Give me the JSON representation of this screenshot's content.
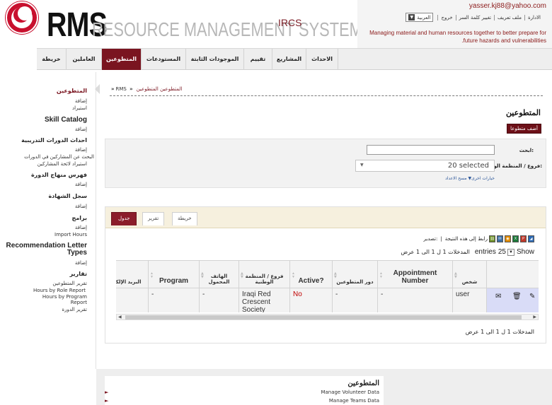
{
  "header": {
    "brand_main": "RMS",
    "brand_sub": "RESOURCE MANAGEMENT SYSTEM",
    "brand_org": "IRCS",
    "user_email": "yasser.kj88@yahoo.com",
    "top_links": [
      "العربية",
      "خروج",
      "تغيير كلمة السر",
      "ملف تعريف",
      "الادارة"
    ],
    "tagline": "Managing material and human resources together to better prepare for .future hazards and vulnerabilities"
  },
  "nav": {
    "items": [
      "خريطة",
      "العاملين",
      "المتطوعين",
      "المستودعات",
      "الموجودات الثابتة",
      "تقييم",
      "المشاريع",
      "الاحداث"
    ]
  },
  "sidebar": {
    "sections": [
      {
        "title": "المتطوعين",
        "links": [
          "إضافة",
          "استيراد"
        ]
      },
      {
        "title": "Skill Catalog",
        "links": [
          "إضافة"
        ]
      },
      {
        "title": "احداث الدورات التدريبية",
        "links": [
          "إضافة",
          "البحث عن المشاركين في الدورات",
          "استيراد لائحة المشاركين"
        ]
      },
      {
        "title": "فهرس منهاج الدورة",
        "links": [
          "إضافة"
        ]
      },
      {
        "title": "سجل الشهادة",
        "links": [
          "إضافة"
        ]
      },
      {
        "title": "برامج",
        "links": [
          "إضافة",
          "Import Hours"
        ]
      },
      {
        "title": "Recommendation Letter Types",
        "links": [
          "إضافة"
        ]
      },
      {
        "title": "تقارير",
        "links": [
          "تقرير المتطوعين",
          "Hours by Role Report",
          "Hours by Program Report",
          "تقرير الدورة"
        ]
      }
    ]
  },
  "breadcrumb": {
    "root": "RMS",
    "sep": "»",
    "section": "المتطوعين",
    "current": "المتطوعين"
  },
  "page": {
    "title": "المتطوعين",
    "add_button": "أضف متطوعا"
  },
  "filters": {
    "search_label": "ابحث:",
    "search_value": "",
    "branch_label": "فروع / المنظمة الوطنية:",
    "branch_value": "20 selected",
    "more_options": "خيارات اخرى▼ مسح الاعداد"
  },
  "tabs": [
    "جدول",
    "تقرير",
    "خريطة"
  ],
  "export": {
    "link": "رابط إلى هذه النتيجة",
    "sep": "|",
    "label": "تصدير:"
  },
  "entries_info_top": "المدخلات 1 ل 1 الى 1 عرض",
  "show_entries": {
    "show": "Show",
    "count": "25",
    "entries": "entries"
  },
  "table": {
    "columns": [
      "البريد الإلكتروني",
      "Program",
      "الهاتف المحمول",
      "فروع / المنظمة الوطنية",
      "Active?",
      "دور المتطوعين",
      "Appointment Number",
      "شخص",
      ""
    ],
    "rows": [
      {
        "email": "-",
        "program": "-",
        "mobile": "-",
        "branch": "Iraqi Red Crescent Society (IRCS)",
        "active": "No",
        "role": "-",
        "appointment": "-",
        "person": "user"
      }
    ]
  },
  "entries_info_bottom": "المدخلات 1 ل 1 الى 1 عرض",
  "footer": {
    "title": "المتطوعين",
    "links": [
      "Manage Volunteer Data",
      "Manage Teams Data"
    ]
  }
}
